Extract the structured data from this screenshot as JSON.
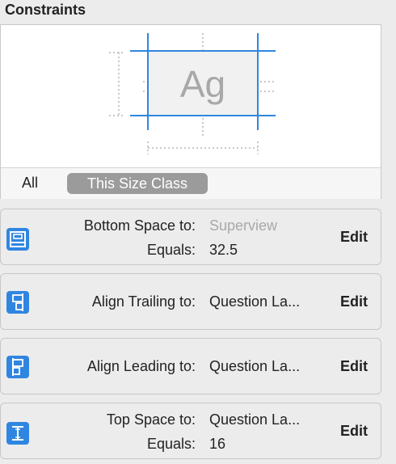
{
  "section_title": "Constraints",
  "preview": {
    "sample_text": "Ag",
    "tabs": {
      "all": "All",
      "size_class": "This Size Class"
    }
  },
  "constraints": [
    {
      "icon": "bottom-space-icon",
      "rows": [
        {
          "label": "Bottom Space to:",
          "value": "Superview",
          "muted": true
        },
        {
          "label": "Equals:",
          "value": "32.5"
        }
      ],
      "edit": "Edit"
    },
    {
      "icon": "align-trailing-icon",
      "rows": [
        {
          "label": "Align Trailing to:",
          "value": "Question La..."
        }
      ],
      "edit": "Edit"
    },
    {
      "icon": "align-leading-icon",
      "rows": [
        {
          "label": "Align Leading to:",
          "value": "Question La..."
        }
      ],
      "edit": "Edit"
    },
    {
      "icon": "top-space-icon",
      "rows": [
        {
          "label": "Top Space to:",
          "value": "Question La..."
        },
        {
          "label": "Equals:",
          "value": "16"
        }
      ],
      "edit": "Edit"
    }
  ],
  "colors": {
    "accent": "#2f86e0",
    "chip": "#9b9b9b"
  }
}
